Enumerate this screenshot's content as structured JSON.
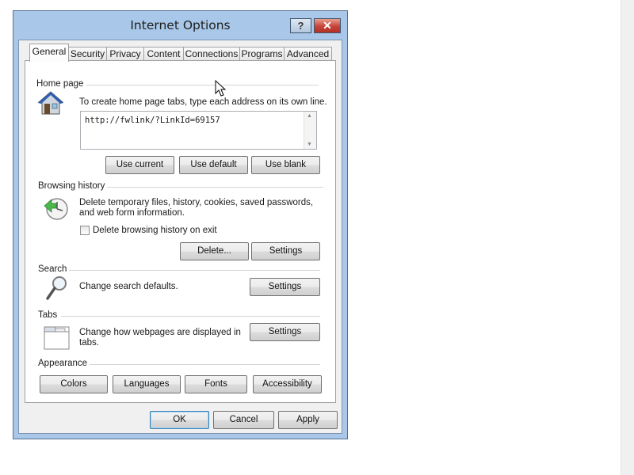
{
  "window": {
    "title": "Internet Options",
    "help_label": "?",
    "close_label": "✕"
  },
  "tabs": [
    {
      "label": "General"
    },
    {
      "label": "Security"
    },
    {
      "label": "Privacy"
    },
    {
      "label": "Content"
    },
    {
      "label": "Connections"
    },
    {
      "label": "Programs"
    },
    {
      "label": "Advanced"
    }
  ],
  "home_page": {
    "section_label": "Home page",
    "description": "To create home page tabs, type each address on its own line.",
    "url_value": "http://fwlink/?LinkId=69157",
    "use_current": "Use current",
    "use_default": "Use default",
    "use_blank": "Use blank"
  },
  "browsing_history": {
    "section_label": "Browsing history",
    "description_line1": "Delete temporary files, history, cookies, saved passwords,",
    "description_line2": "and web form information.",
    "delete_on_exit_label": "Delete browsing history on exit",
    "delete_on_exit_checked": false,
    "delete_button": "Delete...",
    "settings_button": "Settings"
  },
  "search": {
    "section_label": "Search",
    "description": "Change search defaults.",
    "settings_button": "Settings"
  },
  "tabs_section": {
    "section_label": "Tabs",
    "description_line1": "Change how webpages are displayed in",
    "description_line2": "tabs.",
    "settings_button": "Settings"
  },
  "appearance": {
    "section_label": "Appearance",
    "colors": "Colors",
    "languages": "Languages",
    "fonts": "Fonts",
    "accessibility": "Accessibility"
  },
  "footer": {
    "ok": "OK",
    "cancel": "Cancel",
    "apply": "Apply"
  },
  "icons": {
    "home": "home-icon",
    "history": "history-icon",
    "search": "magnifier-icon",
    "tabs": "tabs-icon",
    "help": "help-icon",
    "close": "close-icon",
    "cursor": "mouse-cursor-icon"
  }
}
